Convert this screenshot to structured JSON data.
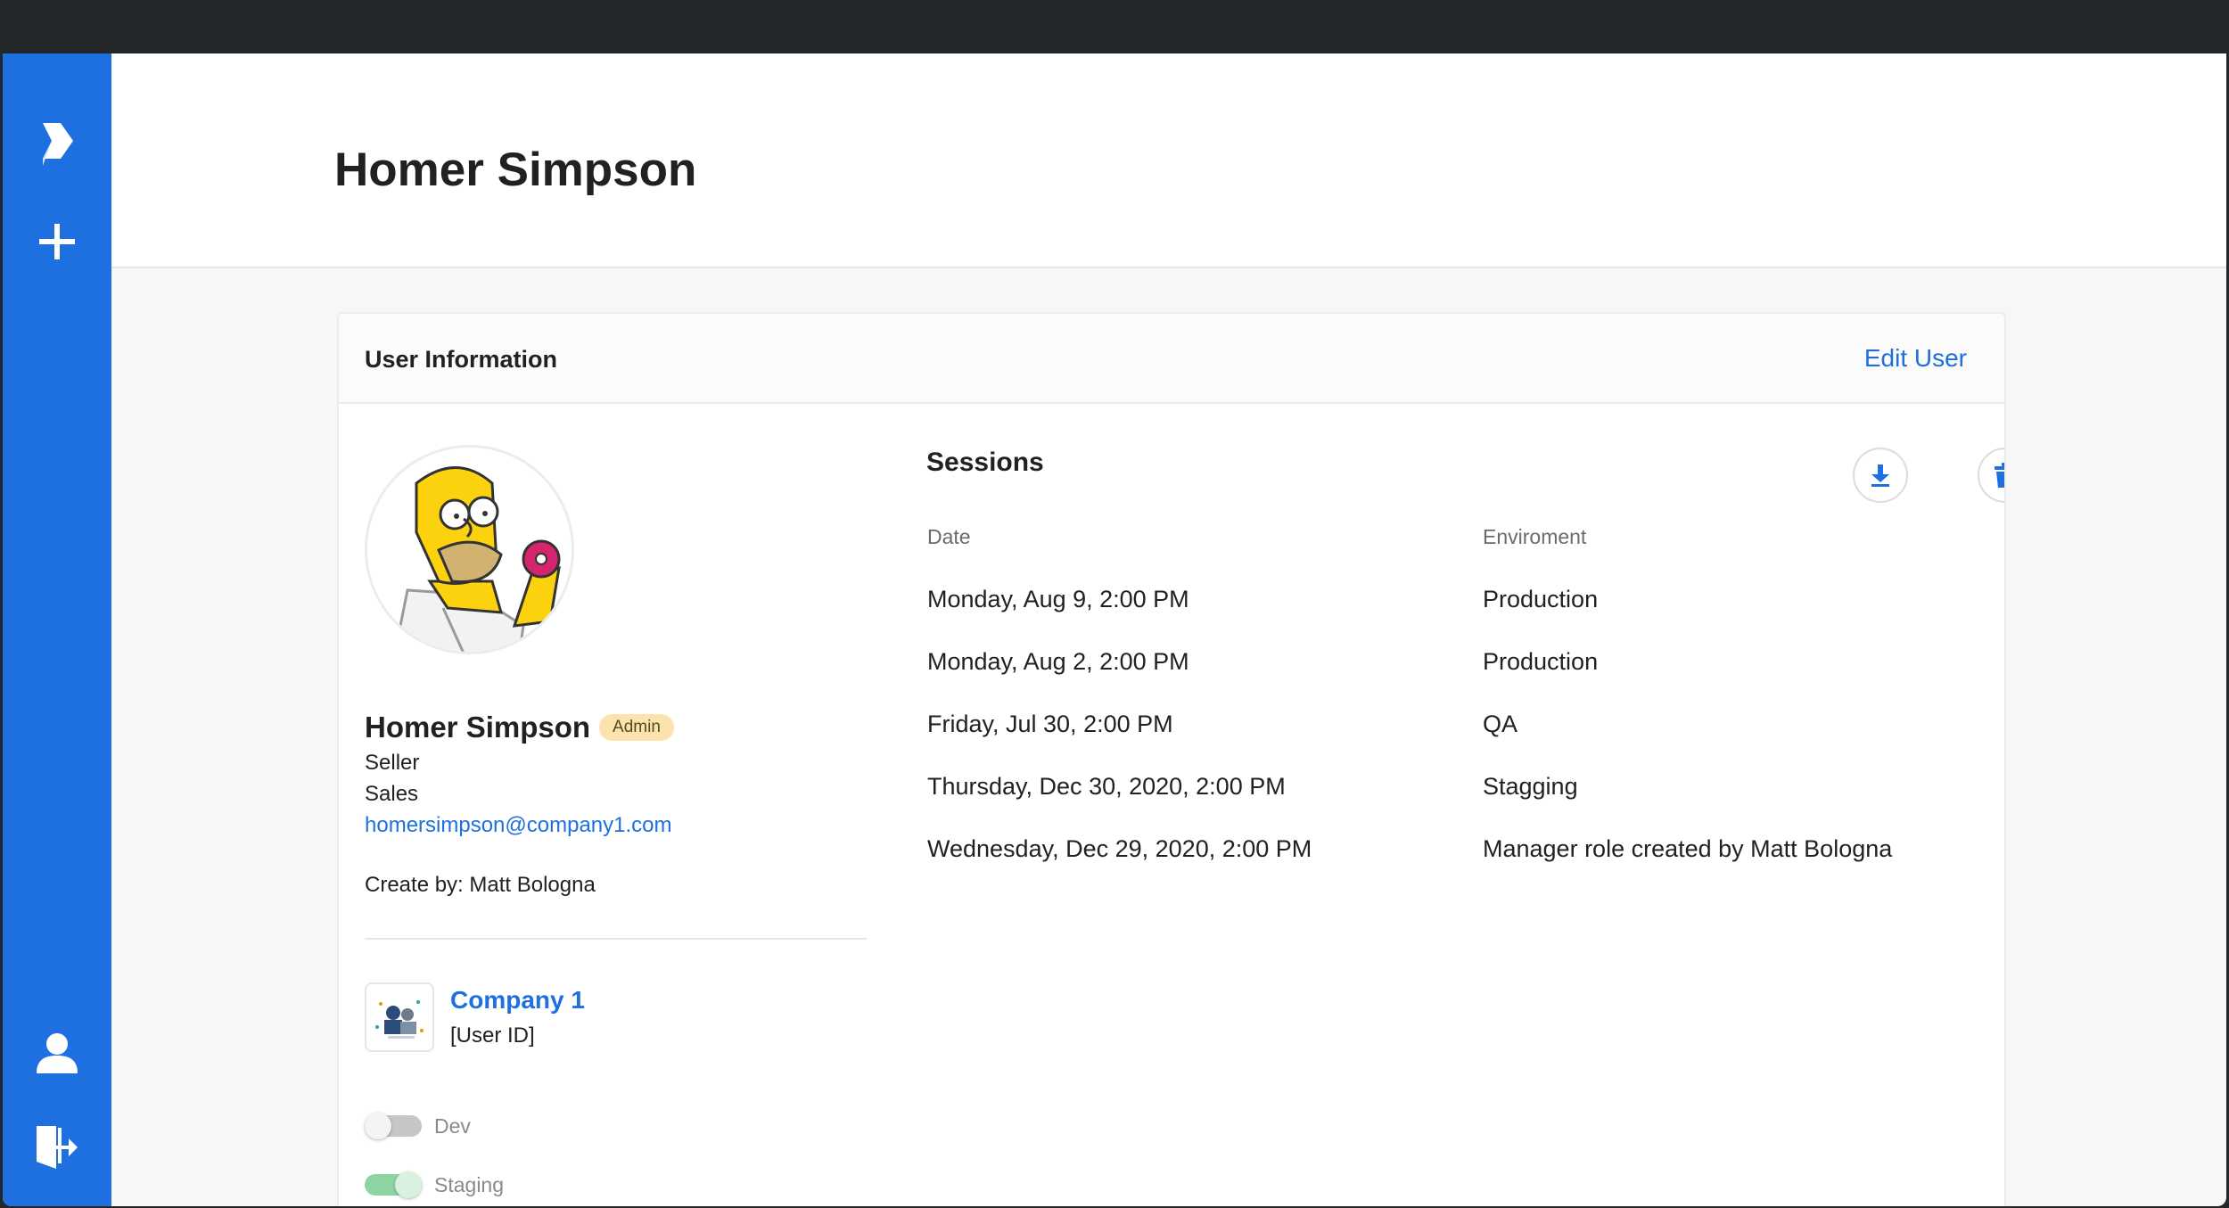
{
  "page": {
    "title": "Homer Simpson"
  },
  "card": {
    "title": "User Information",
    "edit_label": "Edit User"
  },
  "user": {
    "name": "Homer Simpson",
    "role_badge": "Admin",
    "position": "Seller",
    "department": "Sales",
    "email": "homersimpson@company1.com",
    "created_by": "Create by: Matt Bologna"
  },
  "company": {
    "name": "Company 1",
    "user_id": "[User ID]"
  },
  "environments": [
    {
      "label": "Dev",
      "enabled": false
    },
    {
      "label": "Staging",
      "enabled": true
    }
  ],
  "sessions": {
    "title": "Sessions",
    "col_date": "Date",
    "col_env": "Enviroment",
    "rows": [
      {
        "date": "Monday, Aug 9, 2:00 PM",
        "env": "Production"
      },
      {
        "date": "Monday, Aug 2, 2:00 PM",
        "env": "Production"
      },
      {
        "date": "Friday, Jul 30, 2:00 PM",
        "env": "QA"
      },
      {
        "date": "Thursday, Dec 30, 2020, 2:00 PM",
        "env": "Stagging"
      },
      {
        "date": "Wednesday, Dec 29, 2020, 2:00 PM",
        "env": "Manager role created by Matt Bologna"
      }
    ]
  },
  "icons": {
    "logo": "tag-logo-icon",
    "add": "plus-icon",
    "profile": "user-icon",
    "logout": "logout-icon",
    "download": "download-icon",
    "delete": "trash-icon"
  },
  "colors": {
    "accent": "#1e6fe0",
    "badge": "#fbe3ad",
    "toggle_on": "#8ed4a3",
    "frame": "#23272a"
  }
}
